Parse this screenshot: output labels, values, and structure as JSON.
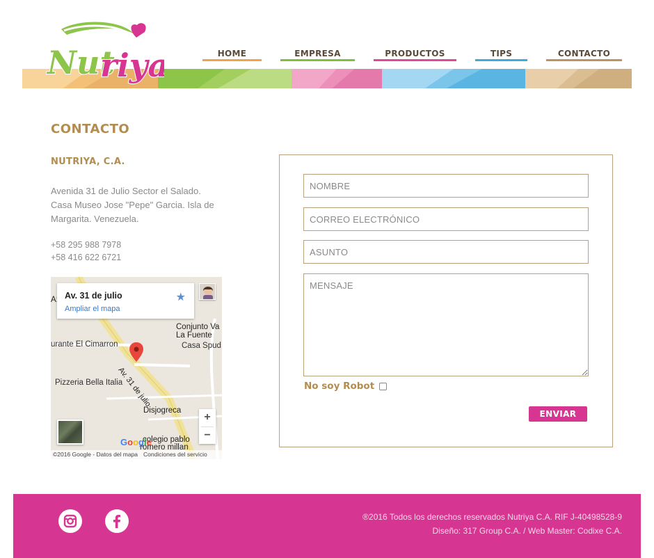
{
  "brand": {
    "logo_text": "Nutriya"
  },
  "nav": {
    "home": "HOME",
    "empresa": "EMPRESA",
    "productos": "PRODUCTOS",
    "tips": "TIPS",
    "contacto": "CONTACTO"
  },
  "contact": {
    "title": "CONTACTO",
    "company": "NUTRIYA, C.A.",
    "address_lines": [
      "Avenida 31 de Julio Sector el Salado.",
      "Casa Museo Jose \"Pepe\" Garcia. Isla de",
      "Margarita. Venezuela."
    ],
    "phones": [
      "+58 295 988 7978",
      "+58 416 622 6721"
    ]
  },
  "map": {
    "place": "Av. 31 de julio",
    "enlarge_link": "Ampliar el mapa",
    "road_label": "Av. 31 de julio",
    "labels": {
      "as": "A:",
      "conjunto_1": "Conjunto Va",
      "conjunto_2": "La Fuente",
      "casa": "Casa Spud",
      "restaurante": "urante El Cimarron",
      "pizzeria": "Pizzeria Bella Italia",
      "disjogreca": "Disjogreca",
      "colegio_1": "colegio pablo",
      "colegio_2": "romero millan"
    },
    "zoom_in": "+",
    "zoom_out": "−",
    "google": "Google",
    "copyright": "©2016 Google - Datos del mapa",
    "terms": "Condiciones del servicio"
  },
  "form": {
    "nombre_placeholder": "NOMBRE",
    "correo_placeholder": "CORREO ELECTRÓNICO",
    "asunto_placeholder": "ASUNTO",
    "mensaje_placeholder": "MENSAJE",
    "robot_label": "No soy Robot",
    "robot_checked": false,
    "submit_label": "ENVIAR"
  },
  "footer": {
    "line1": "®2016 Todos los derechos reservados Nutriya C.A. RIF J-40498528-9",
    "line2": "Diseño: 317 Group C.A. / Web Master: Codixe C.A.",
    "social": [
      "instagram-icon",
      "facebook-icon"
    ]
  },
  "colors": {
    "brand_pink": "#d63592",
    "brand_gold": "#b38c50",
    "logo_green": "#8dc44a",
    "nav_orange": "#f0a34a",
    "nav_green": "#7fbf3a",
    "nav_pink": "#e0489a",
    "nav_blue": "#3fa9e0",
    "nav_tan": "#b99564"
  }
}
